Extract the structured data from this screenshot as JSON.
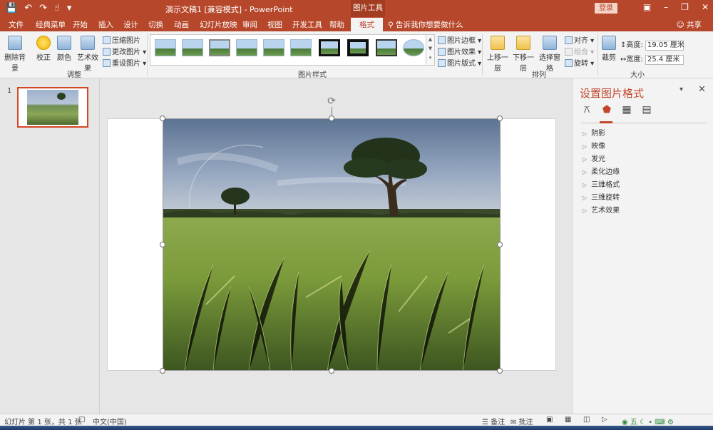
{
  "titlebar": {
    "doc_title": "演示文稿1 [兼容模式] - PowerPoint",
    "context_tab": "图片工具",
    "login": "登录"
  },
  "tabs": {
    "items": [
      "文件",
      "经典菜单",
      "开始",
      "插入",
      "设计",
      "切换",
      "动画",
      "幻灯片放映",
      "审阅",
      "视图",
      "开发工具",
      "帮助"
    ],
    "active": "格式",
    "tell_me": "告诉我你想要做什么",
    "share": "共享"
  },
  "ribbon": {
    "adjust": {
      "remove_bg": "删除背景",
      "correct": "校正",
      "color": "颜色",
      "art_effects": "艺术效果",
      "compress": "压缩图片",
      "change": "更改图片",
      "reset": "重设图片",
      "label": "调整"
    },
    "styles": {
      "label": "图片样式",
      "border": "图片边框",
      "effects": "图片效果",
      "layout": "图片版式"
    },
    "arrange": {
      "bring_forward": "上移一层",
      "send_backward": "下移一层",
      "selection_pane": "选择窗格",
      "align": "对齐",
      "group": "组合",
      "rotate": "旋转",
      "label": "排列"
    },
    "size": {
      "crop": "裁剪",
      "height_label": "高度:",
      "height_value": "19.05 厘米",
      "width_label": "宽度:",
      "width_value": "25.4 厘米",
      "label": "大小"
    }
  },
  "slides": {
    "current_number": "1"
  },
  "format_pane": {
    "title": "设置图片格式",
    "sections": [
      "阴影",
      "映像",
      "发光",
      "柔化边缘",
      "三维格式",
      "三维旋转",
      "艺术效果"
    ]
  },
  "statusbar": {
    "slide_info": "幻灯片 第 1 张，共 1 张",
    "language": "中文(中国)",
    "notes": "备注",
    "comments": "批注"
  },
  "colors": {
    "accent": "#b7472a",
    "pane_title": "#c0452a",
    "ribbon_bg": "#f3f3f3"
  }
}
